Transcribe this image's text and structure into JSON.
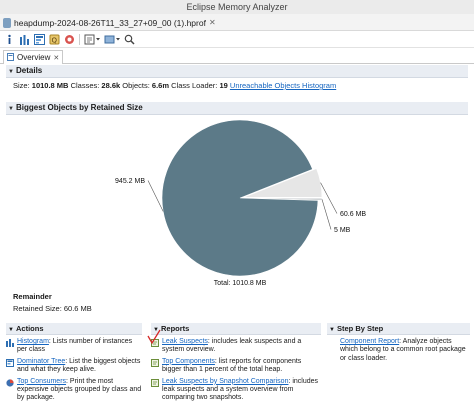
{
  "window": {
    "title": "Eclipse Memory Analyzer"
  },
  "file_tab": {
    "label": "heapdump-2024-08-26T11_33_27+09_00 (1).hprof",
    "close": "✕"
  },
  "editor_tab": {
    "label": "Overview",
    "close": "✕"
  },
  "details": {
    "header": "Details",
    "size_label": "Size:",
    "size_value": "1010.8 MB",
    "classes_label": "Classes:",
    "classes_value": "28.6k",
    "objects_label": "Objects:",
    "objects_value": "6.6m",
    "loader_label": "Class Loader:",
    "loader_value": "19",
    "unreachable_link": "Unreachable Objects Histogram"
  },
  "biggest": {
    "header": "Biggest Objects by Retained Size"
  },
  "chart_data": {
    "type": "pie",
    "slices": [
      {
        "label": "945.2 MB",
        "value": 945.2,
        "color": "#5c7a88"
      },
      {
        "label": "60.6 MB",
        "value": 60.6,
        "color": "#e6e6e6"
      },
      {
        "label": "5 MB",
        "value": 5.0,
        "color": "#d0d4d6"
      }
    ],
    "total_label": "Total: 1010.8 MB"
  },
  "remainder": {
    "title": "Remainder",
    "text": "Retained Size: 60.6 MB"
  },
  "actions": {
    "header": "Actions",
    "items": [
      {
        "link": "Histogram",
        "text": ": Lists number of instances per class"
      },
      {
        "link": "Dominator Tree",
        "text": ": List the  biggest objects and what they keep alive."
      },
      {
        "link": "Top Consumers",
        "text": ": Print the most expensive objects grouped by class and by package."
      }
    ]
  },
  "reports": {
    "header": "Reports",
    "items": [
      {
        "link": "Leak Suspects",
        "text": ": includes leak suspects and a system overview."
      },
      {
        "link": "Top Components",
        "text": ": list reports for components bigger than 1 percent of the total heap."
      },
      {
        "link": "Leak Suspects by Snapshot Comparison",
        "text": ": includes leak suspects and a system overview from comparing two snapshots."
      }
    ]
  },
  "steps": {
    "header": "Step By Step",
    "items": [
      {
        "link": "Component Report",
        "text": ": Analyze objects which belong to a common root package or class loader."
      }
    ]
  }
}
